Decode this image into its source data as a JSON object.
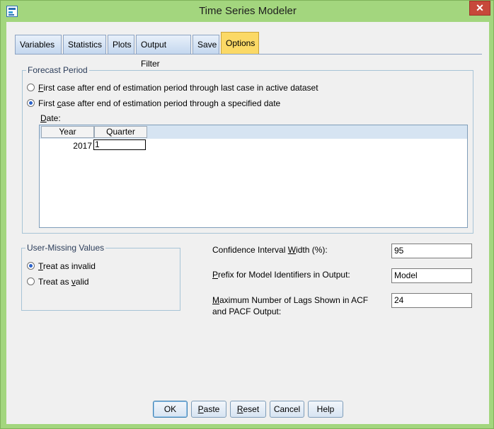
{
  "window": {
    "title": "Time Series Modeler",
    "close_glyph": "✕"
  },
  "tabs": [
    {
      "label": "Variables"
    },
    {
      "label": "Statistics"
    },
    {
      "label": "Plots"
    },
    {
      "label": "Output Filter"
    },
    {
      "label": "Save"
    },
    {
      "label": "Options",
      "active": true
    }
  ],
  "forecast_period": {
    "title": "Forecast Period",
    "option1": {
      "mnemonic": "F",
      "rest": "irst case after end of estimation period through last case in active dataset",
      "checked": false
    },
    "option2": {
      "pre": "First ",
      "mnemonic": "c",
      "rest": "ase after end of estimation period through a specified date",
      "checked": true
    },
    "date_label_mnemonic": "D",
    "date_label_rest": "ate:",
    "columns": [
      "Year",
      "Quarter"
    ],
    "values": {
      "year": "2017",
      "quarter": "1"
    }
  },
  "user_missing": {
    "title": "User-Missing Values",
    "option1": {
      "mnemonic": "T",
      "rest": "reat as invalid",
      "checked": true
    },
    "option2": {
      "pre": "Treat as ",
      "mnemonic": "v",
      "rest": "alid",
      "checked": false
    }
  },
  "settings": {
    "ci_label_pre": "Confidence Interval ",
    "ci_label_mnemonic": "W",
    "ci_label_rest": "idth (%):",
    "ci_value": "95",
    "prefix_mnemonic": "P",
    "prefix_label_rest": "refix for Model Identifiers in Output:",
    "prefix_value": "Model",
    "lags_mnemonic": "M",
    "lags_label_rest": "aximum Number of Lags Shown in ACF",
    "lags_label_line2": "and PACF Output:",
    "lags_value": "24"
  },
  "buttons": {
    "ok": "OK",
    "paste_mnemonic": "P",
    "paste_rest": "aste",
    "reset_mnemonic": "R",
    "reset_rest": "eset",
    "cancel": "Cancel",
    "help": "Help"
  },
  "colors": {
    "frame": "#a3d67e",
    "active_tab": "#fbd966",
    "close": "#c7493b"
  }
}
